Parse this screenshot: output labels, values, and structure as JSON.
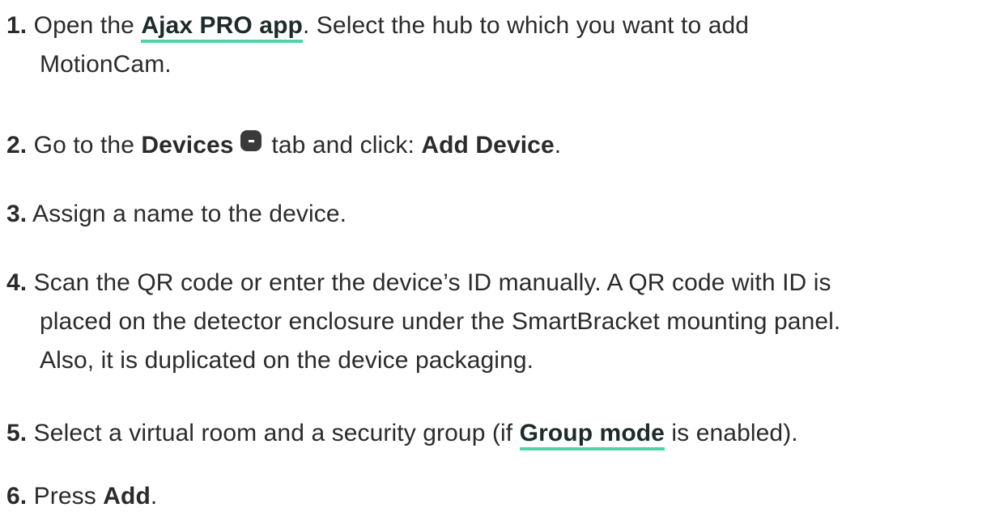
{
  "steps": [
    {
      "num": "1.",
      "t1": "Open the ",
      "link1": "Ajax PRO app",
      "t2": ". Select the hub to which you want to add",
      "t3": "MotionCam."
    },
    {
      "num": "2.",
      "t1": "Go to the ",
      "b1": "Devices",
      "icon": "devices-tab-icon",
      "t2": " tab and click: ",
      "b2": "Add Device",
      "t3": "."
    },
    {
      "num": "3.",
      "t1": "Assign a name to the device."
    },
    {
      "num": "4.",
      "t1": "Scan the QR code or enter the device’s ID manually. A QR code with ID is",
      "t2": "placed on the detector enclosure under the SmartBracket mounting panel.",
      "t3": "Also, it is duplicated on the device packaging."
    },
    {
      "num": "5.",
      "t1": "Select a virtual room and a security group (if ",
      "link1": "Group mode",
      "t2": " is enabled)."
    },
    {
      "num": "6.",
      "t1": "Press ",
      "b1": "Add",
      "t2": "."
    }
  ],
  "colors": {
    "text": "#2b2b2b",
    "link_underline": "#52d3a6",
    "icon": "#3a3a3a"
  }
}
